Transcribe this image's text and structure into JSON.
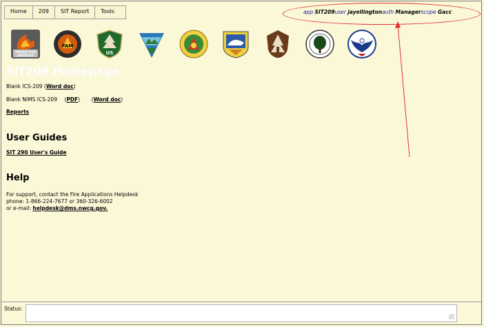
{
  "menu": {
    "items": [
      "Home",
      "209",
      "SIT Report",
      "Tools"
    ]
  },
  "context": {
    "app_label": "app",
    "app_value": "SIT209",
    "user_label": "user",
    "user_value": "jayellington",
    "auth_label": "auth",
    "auth_value": "Manager",
    "scope_label": "scope",
    "scope_value": "Gacc"
  },
  "logos": [
    {
      "icon": "predictive-services-logo",
      "text": "PREDICTIVE SERVICES"
    },
    {
      "icon": "fam-logo",
      "text": "FAM"
    },
    {
      "icon": "forest-service-logo",
      "text": "US"
    },
    {
      "icon": "blm-logo"
    },
    {
      "icon": "bia-logo"
    },
    {
      "icon": "fws-logo"
    },
    {
      "icon": "nps-logo"
    },
    {
      "icon": "usfa-logo"
    },
    {
      "icon": "eagle-logo"
    }
  ],
  "page_title": "SIT209 Homepage",
  "blank_ics": {
    "text": "Blank ICS-209 (",
    "link": "Word doc",
    "close": ")"
  },
  "blank_nims": {
    "text": "Blank NIMS ICS-209",
    "pdf": "PDF",
    "word": "Word doc"
  },
  "reports_link": "Reports",
  "user_guides": {
    "heading": "User Guides",
    "link": "SIT 290 User's Guide"
  },
  "help": {
    "heading": "Help",
    "line1": "For support, contact the Fire Applications Helpdesk",
    "line2": "phone: 1-866-224-7677 or 360-326-6002",
    "email_prefix": "or e-mail:",
    "email": "helpdesk@dms.nwcg.gov."
  },
  "status": {
    "label": "Status:",
    "value": ""
  },
  "colors": {
    "background": "#fbf8d8",
    "annotation": "#e03030",
    "context_label": "#1a1a9a"
  }
}
